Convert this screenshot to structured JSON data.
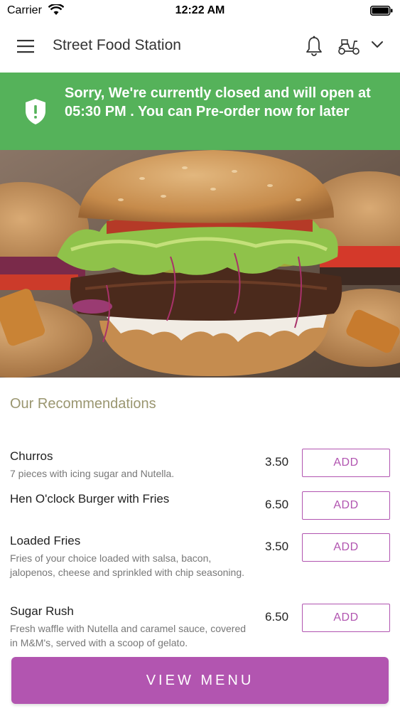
{
  "status_bar": {
    "carrier": "Carrier",
    "time": "12:22 AM"
  },
  "header": {
    "title": "Street Food Station",
    "icons": [
      "menu-icon",
      "bell-icon",
      "scooter-icon",
      "chevron-down-icon"
    ]
  },
  "banner": {
    "message": "Sorry, We're currently closed and will open at 05:30 PM . You can Pre-order now for later",
    "color": "#55b25a",
    "icon": "shield-icon"
  },
  "recommendations": {
    "title": "Our Recommendations",
    "items": [
      {
        "name": "Churros",
        "description": "7 pieces with icing sugar and Nutella.",
        "price": "3.50",
        "button": "ADD"
      },
      {
        "name": "Hen O'clock Burger with Fries",
        "description": "",
        "price": "6.50",
        "button": "ADD"
      },
      {
        "name": "Loaded Fries",
        "description": "Fries of your choice loaded with salsa, bacon, jalopenos, cheese and sprinkled with chip seasoning.",
        "price": "3.50",
        "button": "ADD"
      },
      {
        "name": "Sugar Rush",
        "description": "Fresh waffle with Nutella and caramel sauce, covered in M&M's, served with a scoop of gelato.",
        "price": "6.50",
        "button": "ADD"
      }
    ]
  },
  "footer": {
    "view_menu_label": "VIEW MENU",
    "accent": "#b255b0"
  }
}
